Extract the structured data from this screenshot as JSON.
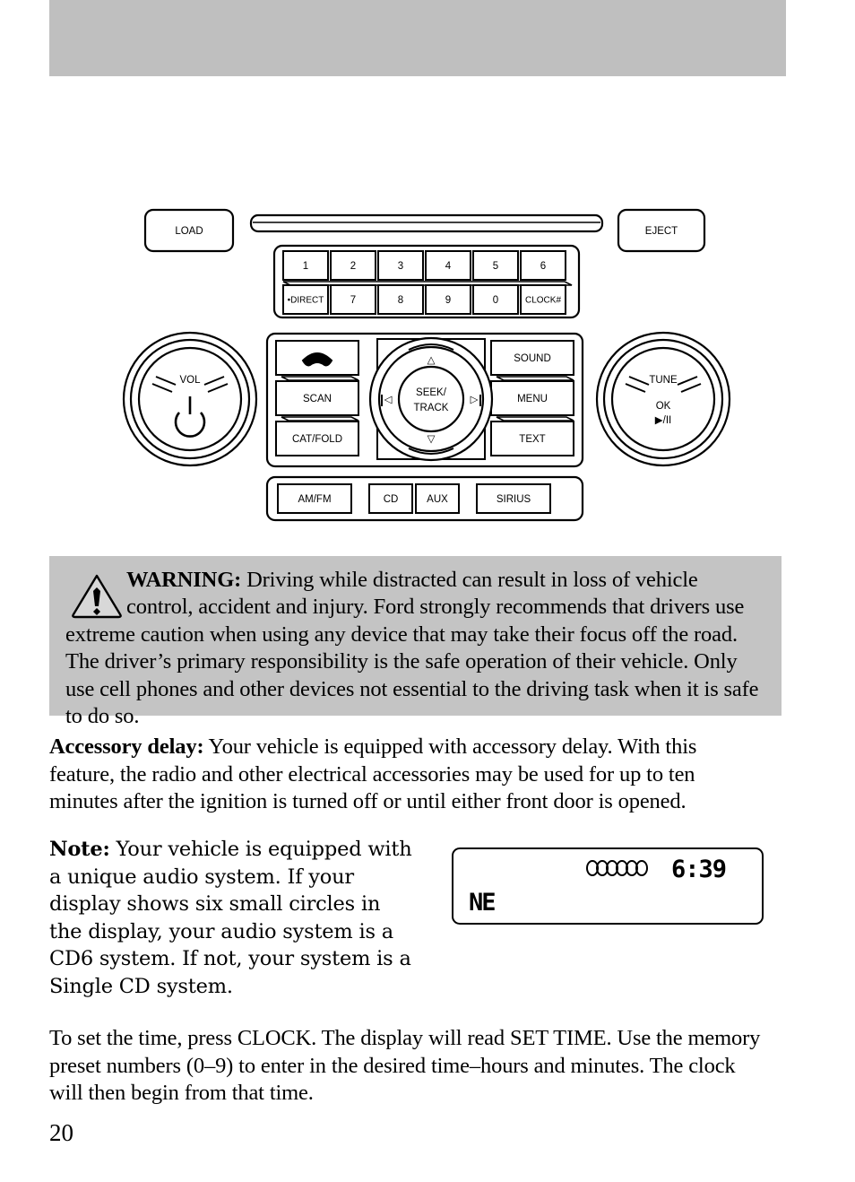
{
  "page": {
    "number": "20",
    "header_band_color": "#bfbfbf",
    "warning_box_color": "#c4c4c4"
  },
  "radio": {
    "diagram_name": "audio-system-faceplate",
    "load_button": "LOAD",
    "eject_button": "EJECT",
    "cd_slot": "cd-slot",
    "presets_row1": [
      "1",
      "2",
      "3",
      "4",
      "5",
      "6"
    ],
    "presets_row2": [
      "•DIRECT",
      "7",
      "8",
      "9",
      "0",
      "CLOCK#"
    ],
    "volume_knob": {
      "label": "VOL",
      "power_icon": "power-icon"
    },
    "tune_knob": {
      "label": "TUNE",
      "ok_label": "OK",
      "play_pause": "▶/II"
    },
    "left_stack": [
      "phone-icon",
      "SCAN",
      "CAT/FOLD"
    ],
    "right_stack": [
      "SOUND",
      "MENU",
      "TEXT"
    ],
    "dpad": {
      "center_line1": "SEEK/",
      "center_line2": "TRACK",
      "up": "△",
      "down": "▽",
      "left": "◁",
      "right": "▷"
    },
    "source_buttons": [
      "AM/FM",
      "CD",
      "AUX",
      "SIRIUS"
    ]
  },
  "warning": {
    "icon": "warning-triangle-icon",
    "label": "WARNING:",
    "text": " Driving while distracted can result in loss of vehicle control, accident and injury. Ford strongly recommends that drivers use extreme caution when using any device that may take their focus off the road. The driver’s primary responsibility is the safe operation of their vehicle. Only use cell phones and other devices not essential to the driving task when it is safe to do so."
  },
  "accessory_delay": {
    "label": "Accessory delay:",
    "text": " Your vehicle is equipped with accessory delay. With this feature, the radio and other electrical accessories may be used for up to ten minutes after the ignition is turned off or until either front door is opened."
  },
  "note": {
    "label": "Note:",
    "text": " Your vehicle is equipped with a unique audio system. If your display shows six small circles in the display, your audio system is a CD6 system. If not, your system is a Single CD system."
  },
  "lcd": {
    "circles_count": 6,
    "time": "6:39",
    "band": "NE"
  },
  "set_time": {
    "text": "To set the time, press CLOCK. The display will read SET TIME. Use the memory preset numbers (0–9) to enter in the desired time–hours and minutes. The clock will then begin from that time."
  }
}
